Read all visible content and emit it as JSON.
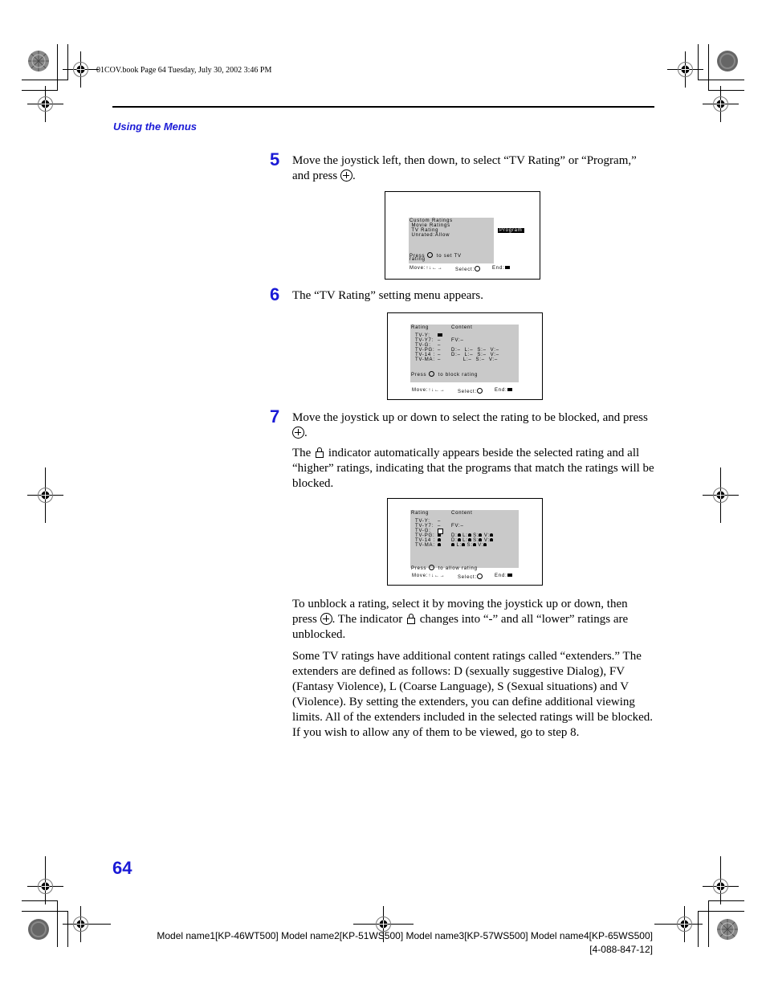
{
  "header": {
    "book_info": "01COV.book  Page 64  Tuesday, July 30, 2002  3:46 PM",
    "section_title": "Using the Menus"
  },
  "steps": [
    {
      "number": "5",
      "text_before": "Move the joystick left, then down, to select “TV Rating” or “Program,” and press ",
      "text_after": ".",
      "icon": "joystick-press-icon"
    },
    {
      "number": "6",
      "text": "The “TV Rating” setting menu appears."
    },
    {
      "number": "7",
      "text_before": "Move the joystick up or down to select the rating to be blocked, and press ",
      "text_after": ".",
      "icon": "joystick-press-icon",
      "note_before": "The ",
      "note_icon": "lock-indicator-icon",
      "note_after": " indicator automatically appears beside the selected rating and all “higher” ratings, indicating that the programs that match the ratings will be blocked."
    }
  ],
  "screens": {
    "custom_ratings": {
      "lines": [
        "Custom Ratings",
        " Movie Ratings",
        " TV Rating",
        " Unrated:Allow"
      ],
      "highlight": "Program",
      "press_text_before": "Press ",
      "press_text_after": "  to set TV",
      "press_text_line2": "rating",
      "move_label": "Move:↑↓←→",
      "select_label": "Select:",
      "end_label": "End:"
    },
    "tv_rating_block": {
      "header_rating": "Rating",
      "header_content": "Content",
      "rows": [
        {
          "label": "TV-Y:",
          "value": "",
          "content": ""
        },
        {
          "label": "TV-Y7:",
          "value": "–",
          "content": "FV:–"
        },
        {
          "label": "TV-G:",
          "value": "–",
          "content": ""
        },
        {
          "label": "TV-PG:",
          "value": "–",
          "content": "D:–  L:–  S:–  V:–"
        },
        {
          "label": "TV-14 :",
          "value": "–",
          "content": "D:–  L:–  S:–  V:–"
        },
        {
          "label": "TV-MA:",
          "value": "–",
          "content": "      L:–  S:–  V:–"
        }
      ],
      "press_text_before": "Press ",
      "press_text_after": "  to block rating",
      "move_label": "Move:↑↓←→",
      "select_label": "Select:",
      "end_label": "End:"
    },
    "tv_rating_allow": {
      "header_rating": "Rating",
      "header_content": "Content",
      "rows": [
        {
          "label": "TV-Y:",
          "value": "–",
          "content": ""
        },
        {
          "label": "TV-Y7:",
          "value": "–",
          "content": "FV:–"
        },
        {
          "label": "TV-G:",
          "value": "",
          "content": ""
        },
        {
          "label": "TV-PG:",
          "value": "lock",
          "content": "D:lock L:lock S:lock V:lock"
        },
        {
          "label": "TV-14 :",
          "value": "lock",
          "content": "D:lock L:lock S:lock V:lock"
        },
        {
          "label": "TV-MA:",
          "value": "lock",
          "content": "lock L:lock S:lock V:lock"
        }
      ],
      "press_text_before": "Press ",
      "press_text_after": "  to allow rating",
      "move_label": "Move:↑↓←→",
      "select_label": "Select:",
      "end_label": "End:"
    }
  },
  "body": {
    "unblock_before": "To unblock a rating, select it by moving the joystick up or down, then press ",
    "unblock_mid": ". The indicator ",
    "unblock_after": " changes into “-” and all “lower” ratings are unblocked.",
    "extenders": "Some TV ratings have additional content ratings called “extenders.” The extenders are defined as follows: D (sexually suggestive Dialog), FV (Fantasy Violence), L (Coarse Language), S (Sexual situations) and V (Violence). By setting the extenders, you can define additional viewing limits. All of the extenders included in the selected ratings will be blocked. If you wish to allow any of them to be viewed, go to step 8."
  },
  "footer": {
    "page_number": "64",
    "models": "Model name1[KP-46WT500] Model name2[KP-51WS500] Model name3[KP-57WS500] Model name4[KP-65WS500]",
    "part_number": "[4-088-847-12]"
  }
}
